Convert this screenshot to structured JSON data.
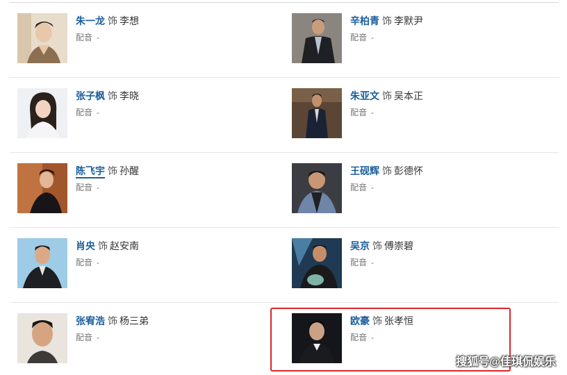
{
  "as_word": "饰",
  "dub_label": "配音",
  "dub_value": "-",
  "cast": [
    {
      "actor": "朱一龙",
      "role": "李想",
      "dub": "-"
    },
    {
      "actor": "辛柏青",
      "role": "李默尹",
      "dub": "-"
    },
    {
      "actor": "张子枫",
      "role": "李晓",
      "dub": "-"
    },
    {
      "actor": "朱亚文",
      "role": "吴本正",
      "dub": "-"
    },
    {
      "actor": "陈飞宇",
      "role": "孙醒",
      "dub": "-"
    },
    {
      "actor": "王砚辉",
      "role": "彭德怀",
      "dub": "-"
    },
    {
      "actor": "肖央",
      "role": "赵安南",
      "dub": "-"
    },
    {
      "actor": "吴京",
      "role": "傅崇碧",
      "dub": "-"
    },
    {
      "actor": "张宥浩",
      "role": "杨三弟",
      "dub": "-"
    },
    {
      "actor": "欧豪",
      "role": "张孝恒",
      "dub": "-"
    }
  ],
  "watermark": "搜狐号@佳琪侃娱乐",
  "colors": {
    "actor_link": "#1a5d9b",
    "highlight_border": "#d9262c",
    "divider": "#e5e5e5"
  }
}
